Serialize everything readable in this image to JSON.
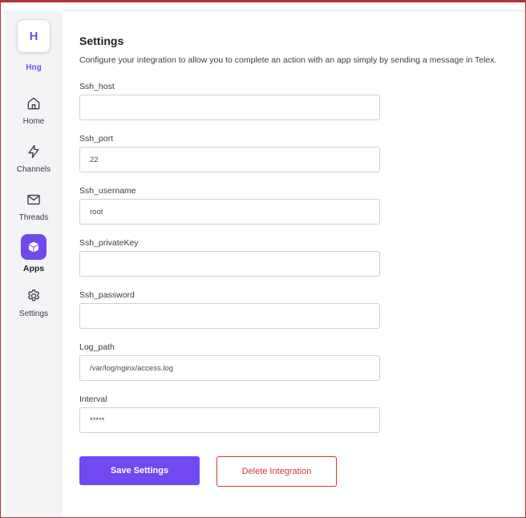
{
  "sidebar": {
    "workspace": {
      "initial": "H",
      "name": "Hng"
    },
    "items": [
      {
        "label": "Home",
        "icon": "home-icon"
      },
      {
        "label": "Channels",
        "icon": "lightning-icon"
      },
      {
        "label": "Threads",
        "icon": "mail-icon"
      },
      {
        "label": "Apps",
        "icon": "cube-icon",
        "active": true
      },
      {
        "label": "Settings",
        "icon": "gear-icon"
      }
    ]
  },
  "colors": {
    "accent": "#7049f0",
    "danger": "#cf3a3a",
    "sidebar_bg": "#f3f4f6"
  },
  "main": {
    "title": "Settings",
    "description": "Configure your integration to allow you to complete an action with an app simply by sending a message in Telex.",
    "fields": [
      {
        "label": "Ssh_host",
        "value": ""
      },
      {
        "label": "Ssh_port",
        "value": "22"
      },
      {
        "label": "Ssh_username",
        "value": "root"
      },
      {
        "label": "Ssh_privateKey",
        "value": ""
      },
      {
        "label": "Ssh_password",
        "value": ""
      },
      {
        "label": "Log_path",
        "value": "/var/log/nginx/access.log"
      },
      {
        "label": "Interval",
        "value": "*****"
      }
    ],
    "save_label": "Save Settings",
    "delete_label": "Delete Integration"
  }
}
